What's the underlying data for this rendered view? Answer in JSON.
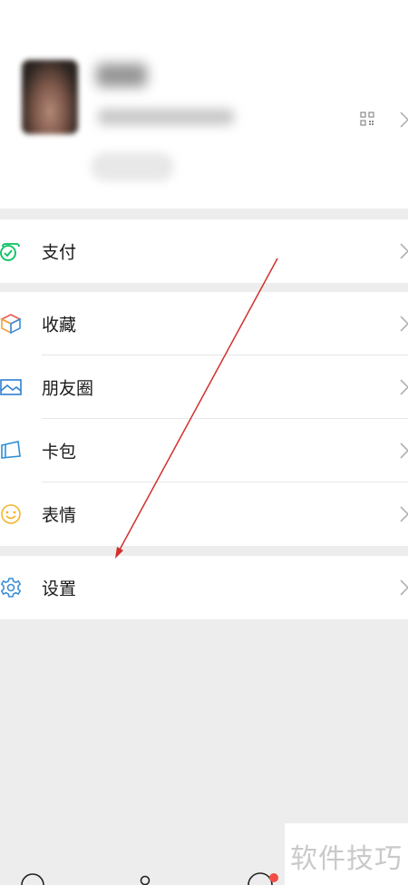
{
  "menu": {
    "pay": {
      "label": "支付",
      "icon": "wallet-check-icon",
      "color": "#07c160"
    },
    "favorites": {
      "label": "收藏",
      "icon": "cube-icon",
      "color": "#f0a03c"
    },
    "moments": {
      "label": "朋友圈",
      "icon": "picture-icon",
      "color": "#2f7fd0"
    },
    "cards": {
      "label": "卡包",
      "icon": "card-icon",
      "color": "#2f8ed6"
    },
    "stickers": {
      "label": "表情",
      "icon": "smile-icon",
      "color": "#f1b62a"
    },
    "settings": {
      "label": "设置",
      "icon": "gear-icon",
      "color": "#3c8fd9"
    }
  },
  "watermark": "软件技巧",
  "annotation": {
    "type": "arrow",
    "color": "#d0312d",
    "points_to": "settings"
  },
  "notification_badge_color": "#f34c44"
}
